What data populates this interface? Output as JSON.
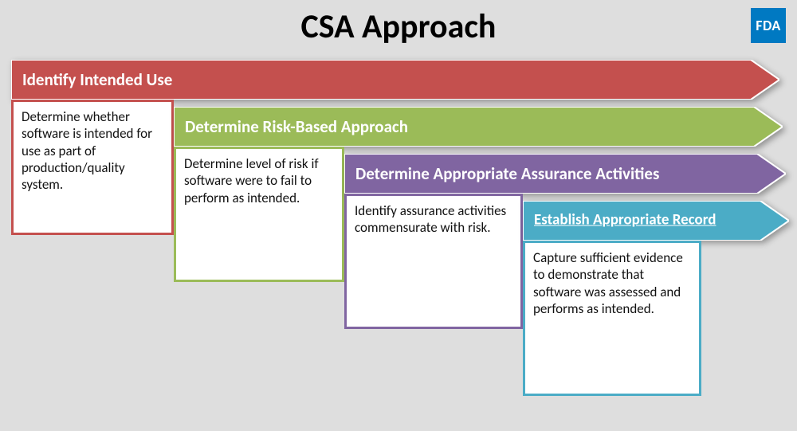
{
  "title": "CSA Approach",
  "fda_label": "FDA",
  "steps": [
    {
      "label": "Identify Intended Use",
      "description": "Determine whether software is intended for use as part of production/quality system.",
      "color": "#c4504e"
    },
    {
      "label": "Determine Risk-Based Approach",
      "description": "Determine level of risk if software were to fail to perform as intended.",
      "color": "#9bbb58"
    },
    {
      "label": "Determine Appropriate Assurance Activities",
      "description": "Identify assurance activities commensurate with risk.",
      "color": "#8065a1"
    },
    {
      "label": "Establish Appropriate Record",
      "description": "Capture sufficient evidence to demonstrate that software was assessed and performs as intended.",
      "color": "#4bacc6"
    }
  ]
}
